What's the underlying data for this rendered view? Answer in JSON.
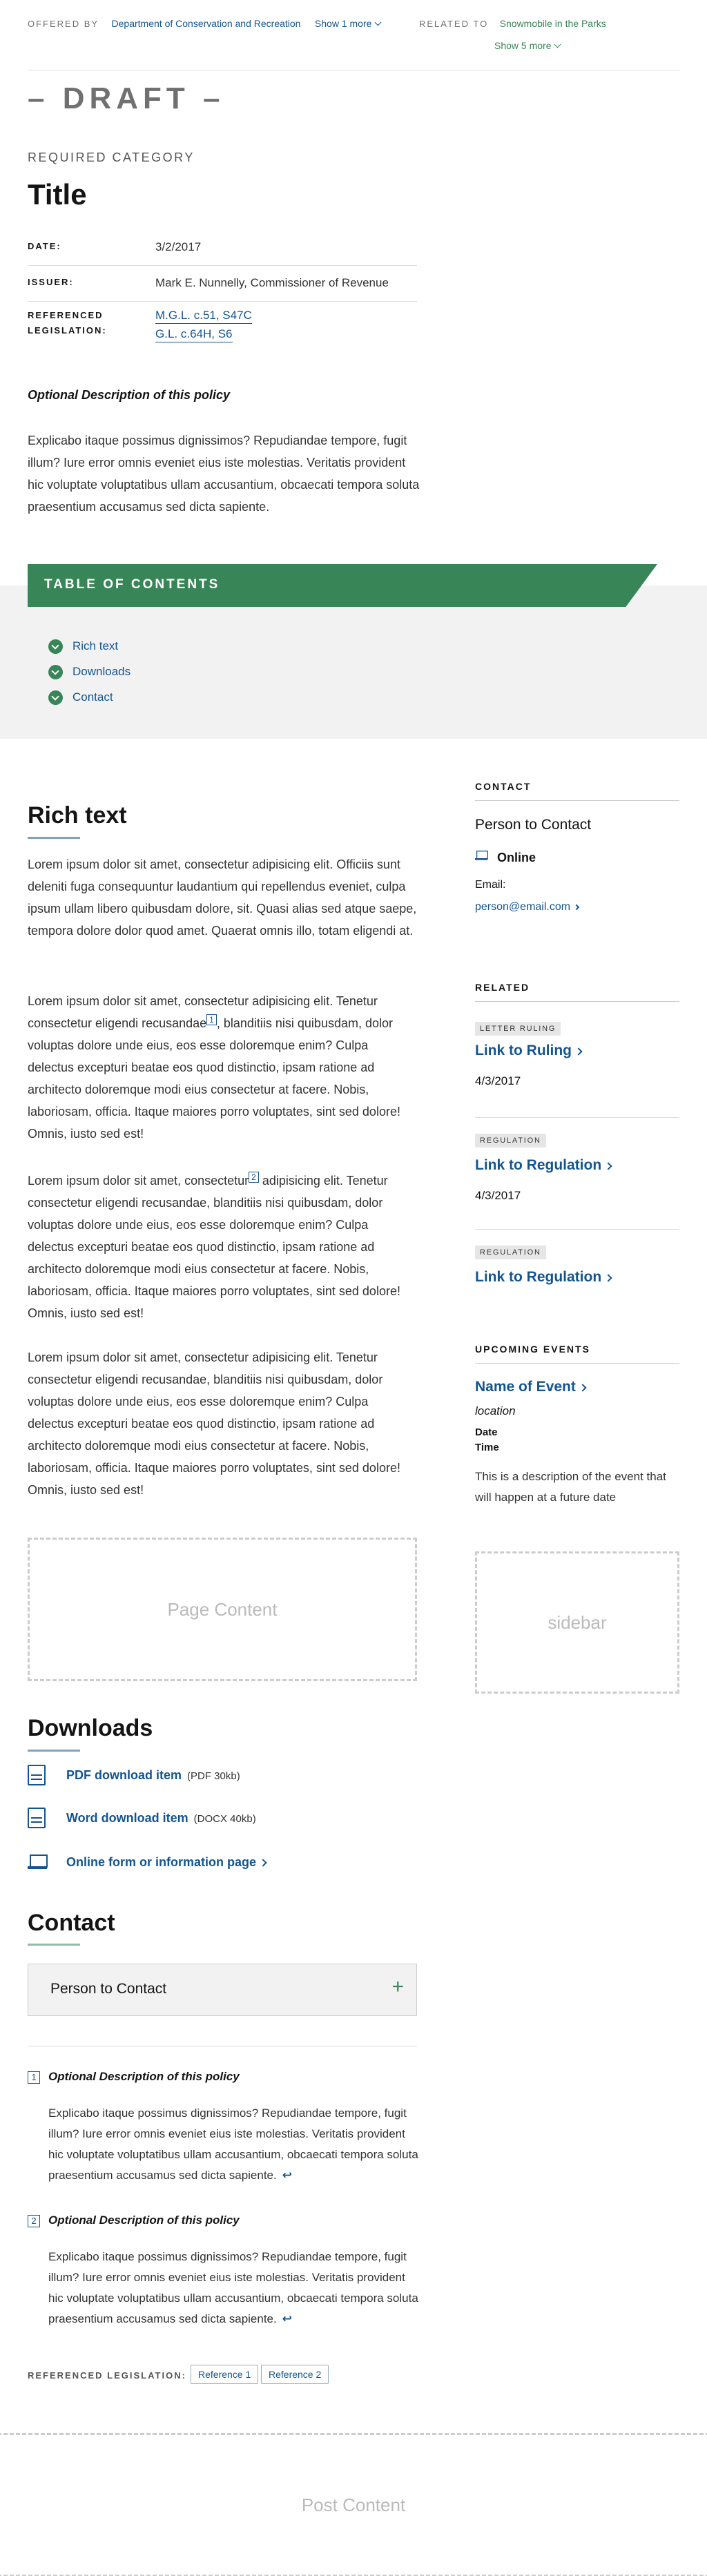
{
  "topbar": {
    "offered_label": "OFFERED BY",
    "offered_link": "Department of Conservation and Recreation",
    "show_more_offered": "Show 1 more",
    "related_label": "RELATED TO",
    "related_link": "Snowmobile in the Parks",
    "show_more_related": "Show 5 more"
  },
  "draft": "– DRAFT –",
  "category": "REQUIRED CATEGORY",
  "title": "Title",
  "meta": {
    "date_label": "DATE:",
    "date_value": "3/2/2017",
    "issuer_label": "ISSUER:",
    "issuer_value": "Mark E. Nunnelly, Commissioner of Revenue",
    "leg_label": "REFERENCED LEGISLATION:",
    "leg_links": [
      "M.G.L. c.51, S47C",
      "G.L. c.64H, S6"
    ]
  },
  "description": {
    "heading": "Optional Description of this policy",
    "text": "Explicabo itaque possimus dignissimos? Repudiandae tempore, fugit illum? Iure error omnis eveniet eius iste molestias. Veritatis provident hic voluptate voluptatibus ullam accusantium, obcaecati tempora soluta praesentium accusamus sed dicta sapiente."
  },
  "toc": {
    "title": "TABLE OF CONTENTS",
    "items": [
      "Rich text",
      "Downloads",
      "Contact"
    ]
  },
  "rich_text": {
    "heading": "Rich text",
    "p1": "Lorem ipsum dolor sit amet, consectetur adipisicing elit. Officiis sunt deleniti fuga consequuntur laudantium qui repellendus eveniet, culpa ipsum ullam libero quibusdam dolore, sit. Quasi alias sed atque saepe, tempora dolore dolor quod amet. Quaerat omnis illo, totam eligendi at.",
    "p2_a": "Lorem ipsum dolor sit amet, consectetur adipisicing elit. Tenetur consectetur eligendi recusandae",
    "p2_fn": "1",
    "p2_b": ", blanditiis nisi quibusdam, dolor voluptas dolore unde eius, eos esse doloremque enim? Culpa delectus excepturi beatae eos quod distinctio, ipsam ratione ad architecto doloremque modi eius consectetur at facere. Nobis, laboriosam, officia. Itaque maiores porro voluptates, sint sed dolore! Omnis, iusto sed est!",
    "p3_a": "Lorem ipsum dolor sit amet, consectetur",
    "p3_fn": "2",
    "p3_b": " adipisicing elit. Tenetur consectetur eligendi recusandae, blanditiis nisi quibusdam, dolor voluptas dolore unde eius, eos esse doloremque enim? Culpa delectus excepturi beatae eos quod distinctio, ipsam ratione ad architecto doloremque modi eius consectetur at facere. Nobis, laboriosam, officia. Itaque maiores porro voluptates, sint sed dolore! Omnis, iusto sed est!",
    "p4": "Lorem ipsum dolor sit amet, consectetur adipisicing elit. Tenetur consectetur eligendi recusandae, blanditiis nisi quibusdam, dolor voluptas dolore unde eius, eos esse doloremque enim? Culpa delectus excepturi beatae eos quod distinctio, ipsam ratione ad architecto doloremque modi eius consectetur at facere. Nobis, laboriosam, officia. Itaque maiores porro voluptates, sint sed dolore! Omnis, iusto sed est!"
  },
  "page_content_placeholder": "Page Content",
  "downloads": {
    "heading": "Downloads",
    "pdf_label": "PDF download item",
    "pdf_meta": "(PDF 30kb)",
    "word_label": "Word download item",
    "word_meta": "(DOCX 40kb)",
    "online_label": "Online form or information page"
  },
  "contact": {
    "heading": "Contact",
    "accordion_label": "Person to Contact"
  },
  "footnotes": [
    {
      "num": "1",
      "heading": "Optional Description of this policy",
      "text": "Explicabo itaque possimus dignissimos? Repudiandae tempore, fugit illum? Iure error omnis eveniet eius iste molestias. Veritatis provident hic voluptate voluptatibus ullam accusantium, obcaecati tempora soluta praesentium accusamus sed dicta sapiente.",
      "return": "↩"
    },
    {
      "num": "2",
      "heading": "Optional Description of this policy",
      "text": "Explicabo itaque possimus dignissimos? Repudiandae tempore, fugit illum? Iure error omnis eveniet eius iste molestias. Veritatis provident hic voluptate voluptatibus ullam accusantium, obcaecati tempora soluta praesentium accusamus sed dicta sapiente.",
      "return": "↩"
    }
  ],
  "references": {
    "label": "REFERENCED LEGISLATION:",
    "buttons": [
      "Reference 1",
      "Reference 2"
    ]
  },
  "post_content_placeholder": "Post Content",
  "sidebar": {
    "contact_heading": "CONTACT",
    "contact_name": "Person to Contact",
    "online_label": "Online",
    "email_label": "Email:",
    "email_value": "person@email.com",
    "related_heading": "RELATED",
    "related": [
      {
        "badge": "LETTER RULING",
        "link": "Link to Ruling",
        "date": "4/3/2017"
      },
      {
        "badge": "REGULATION",
        "link": "Link to Regulation",
        "date": "4/3/2017"
      },
      {
        "badge": "REGULATION",
        "link": "Link to Regulation",
        "date": ""
      }
    ],
    "events_heading": "UPCOMING EVENTS",
    "event_name": "Name of Event",
    "event_location": "location",
    "event_date": "Date",
    "event_time": "Time",
    "event_desc": "This is a description of the event that will happen at a future date",
    "placeholder": "sidebar"
  },
  "colors": {
    "accent_green": "#388557",
    "link_blue": "#14558f"
  }
}
